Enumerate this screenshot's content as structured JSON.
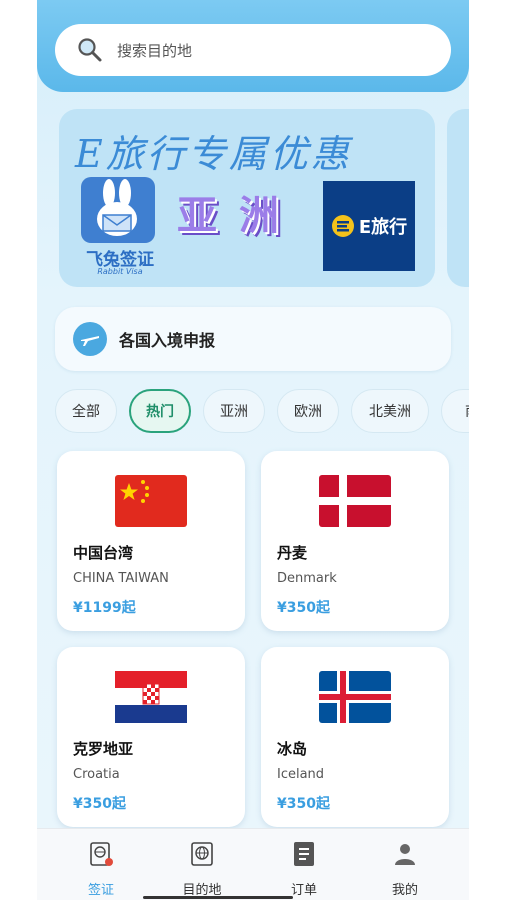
{
  "search": {
    "placeholder": "搜索目的地",
    "icon": "search-icon"
  },
  "banner": {
    "title": "E旅行专属优惠",
    "region": "亚洲",
    "partner_name": "飞兔签证",
    "partner_sub": "Rabbit Visa",
    "brand_text": "E旅行"
  },
  "entry": {
    "label": "各国入境申报",
    "icon": "airplane-icon"
  },
  "filters": [
    "全部",
    "热门",
    "亚洲",
    "欧洲",
    "北美洲",
    "南"
  ],
  "active_filter": "热门",
  "destinations": [
    {
      "name": "中国台湾",
      "english": "CHINA TAIWAN",
      "price": "¥1199起",
      "flag": "red-flag-with-stars"
    },
    {
      "name": "丹麦",
      "english": "Denmark",
      "price": "¥350起",
      "flag": "denmark-flag"
    },
    {
      "name": "克罗地亚",
      "english": "Croatia",
      "price": "¥350起",
      "flag": "croatia-flag"
    },
    {
      "name": "冰岛",
      "english": "Iceland",
      "price": "¥350起",
      "flag": "iceland-flag"
    }
  ],
  "tabbar": [
    {
      "label": "签证",
      "icon": "visa-icon",
      "active": true
    },
    {
      "label": "目的地",
      "icon": "destination-icon",
      "active": false
    },
    {
      "label": "订单",
      "icon": "orders-icon",
      "active": false
    },
    {
      "label": "我的",
      "icon": "profile-icon",
      "active": false
    }
  ],
  "colors": {
    "accent": "#3a9ee0",
    "header": "#5bb8ea",
    "active_chip": "#2aa37c"
  }
}
